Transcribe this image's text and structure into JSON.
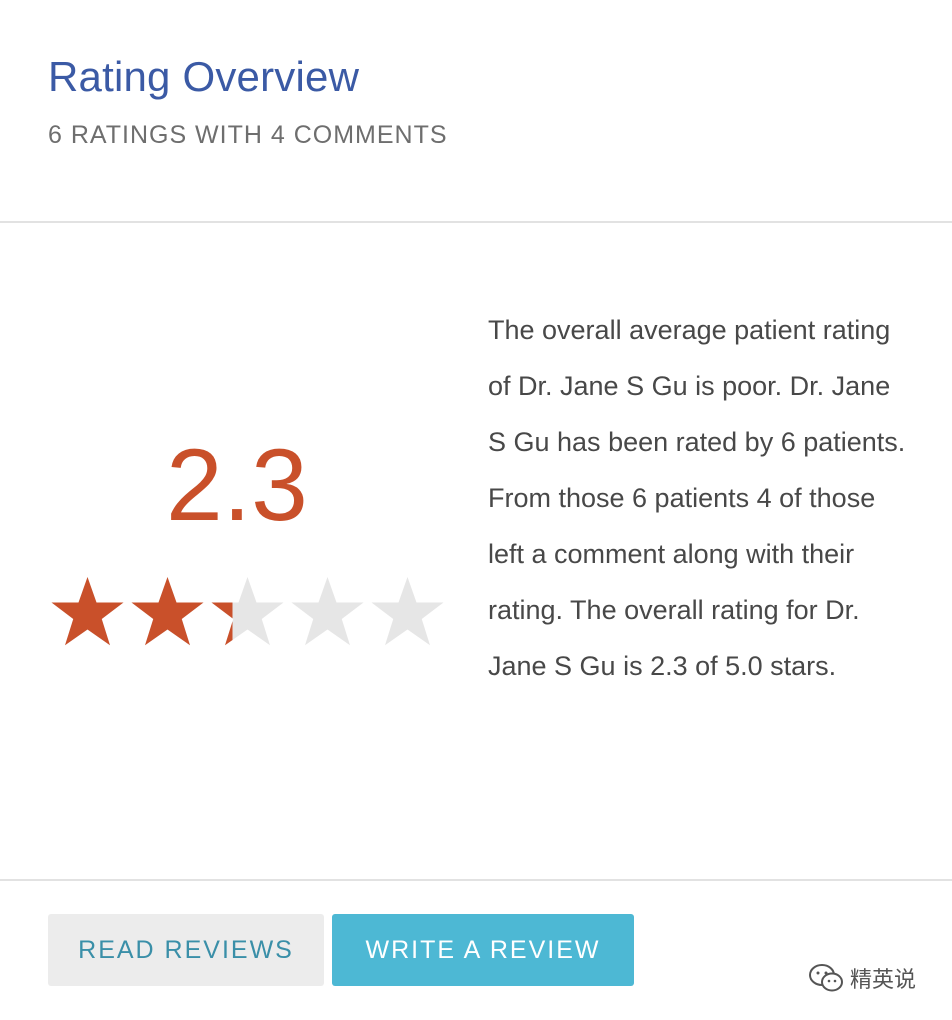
{
  "header": {
    "title": "Rating Overview",
    "subtitle": "6 RATINGS WITH 4 COMMENTS"
  },
  "rating": {
    "score": "2.3",
    "value": 2.3,
    "max": 5,
    "star_filled_color": "#c9502a",
    "star_empty_color": "#e6e6e6",
    "star_icon": "star-icon"
  },
  "description": "The overall average patient rating of Dr. Jane S Gu is poor. Dr. Jane S Gu has been rated by 6 patients. From those 6 patients 4 of those left a comment along with their rating. The overall rating for Dr. Jane S Gu is 2.3 of 5.0 stars.",
  "actions": {
    "read_label": "READ REVIEWS",
    "write_label": "WRITE A REVIEW"
  },
  "colors": {
    "title": "#3b5aa5",
    "accent": "#c9502a",
    "primary_button": "#4db8d4",
    "secondary_button": "#ececec"
  },
  "watermark": {
    "icon": "wechat-icon",
    "text": "精英说"
  }
}
